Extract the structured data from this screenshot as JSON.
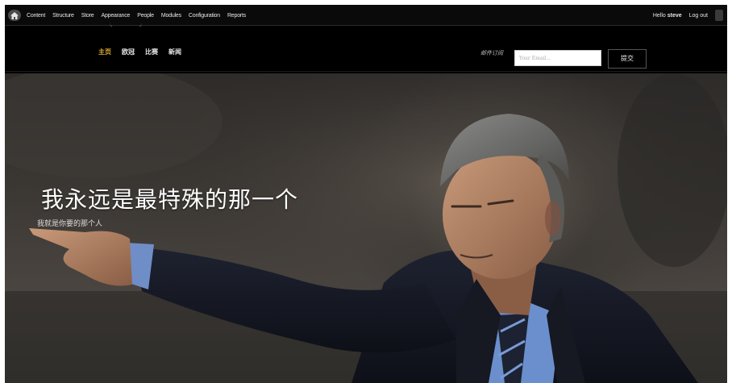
{
  "admin_bar": {
    "menu": [
      "Content",
      "Structure",
      "Store",
      "Appearance",
      "People",
      "Modules",
      "Configuration",
      "Reports"
    ],
    "hello_prefix": "Hello ",
    "username": "steve",
    "logout": "Log out"
  },
  "header": {
    "nav": [
      "主页",
      "欧冠",
      "比赛",
      "新闻"
    ],
    "active_nav_color": "#e0b030",
    "subscribe_label": "邮件订阅",
    "email_placeholder": "Your Email...",
    "submit_label": "提交"
  },
  "hero": {
    "title": "我永远是最特殊的那一个",
    "subtitle": "我就是你要的那个人"
  },
  "icons": {
    "home": "home-icon",
    "shortcuts": "shortcuts-toggle-icon"
  }
}
